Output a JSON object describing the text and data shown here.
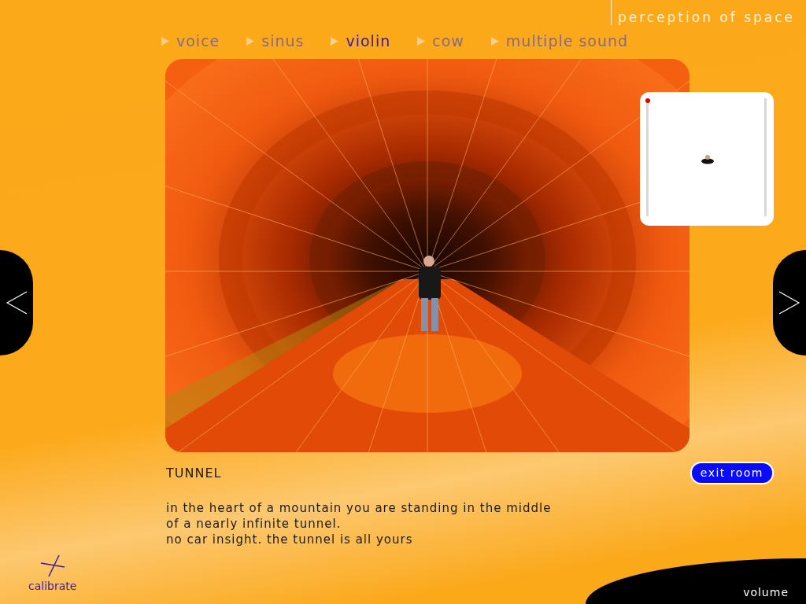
{
  "header": {
    "title": "perception of space"
  },
  "sounds": [
    {
      "label": "voice",
      "selected": false
    },
    {
      "label": "sinus",
      "selected": false
    },
    {
      "label": "violin",
      "selected": true
    },
    {
      "label": "cow",
      "selected": false
    },
    {
      "label": "multiple sound",
      "selected": false
    }
  ],
  "room": {
    "title": "TUNNEL",
    "description": [
      "in the heart of a mountain you are standing in the middle",
      "of a nearly infinite tunnel.",
      "no car insight. the tunnel is all yours"
    ]
  },
  "exit_button": "exit room",
  "calibrate": "calibrate",
  "volume": "volume"
}
